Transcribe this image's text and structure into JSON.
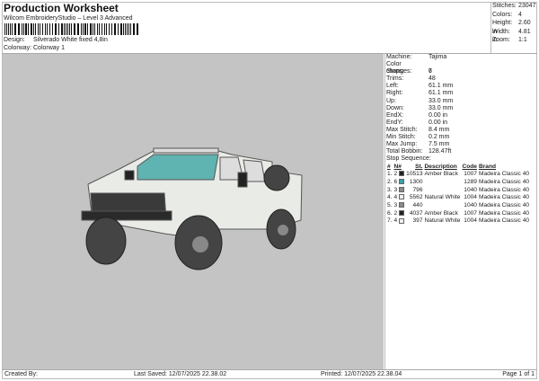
{
  "header": {
    "title": "Production Worksheet",
    "subtitle": "Wilcom EmbroideryStudio – Level 3 Advanced",
    "design_label": "Design:",
    "design": "Silverado White fixed 4,8in",
    "colorway_label": "Colorway:",
    "colorway": "Colorway 1"
  },
  "stats": [
    {
      "k": "Stitches:",
      "v": "23047"
    },
    {
      "k": "Colors:",
      "v": "4"
    },
    {
      "k": "Height:",
      "v": "2.60 in"
    },
    {
      "k": "Width:",
      "v": "4.81 in"
    },
    {
      "k": "Zoom:",
      "v": "1:1"
    }
  ],
  "info": [
    {
      "k": "Machine:",
      "v": "Tajima"
    },
    {
      "k": "Color changes:",
      "v": "6"
    },
    {
      "k": "Stops:",
      "v": "7"
    },
    {
      "k": "Trims:",
      "v": "48"
    },
    {
      "k": "Left:",
      "v": "61.1 mm"
    },
    {
      "k": "Right:",
      "v": "61.1 mm"
    },
    {
      "k": "Up:",
      "v": "33.0 mm"
    },
    {
      "k": "Down:",
      "v": "33.0 mm"
    },
    {
      "k": "EndX:",
      "v": "0.00 in"
    },
    {
      "k": "EndY:",
      "v": "0.00 in"
    },
    {
      "k": "Max Stitch:",
      "v": "8.4 mm"
    },
    {
      "k": "Min Stitch:",
      "v": "0.2 mm"
    },
    {
      "k": "Max Jump:",
      "v": "7.5 mm"
    },
    {
      "k": "Total Bobbin:",
      "v": "128.47ft"
    }
  ],
  "stop_sequence": {
    "label": "Stop Sequence:",
    "headers": [
      "#",
      "N#",
      "St.",
      "Description",
      "Code",
      "Brand"
    ],
    "rows": [
      {
        "i": "1.",
        "n": "2",
        "color": "#222222",
        "st": "10513",
        "desc": "Amber Black",
        "code": "1007",
        "brand": "Madeira Classic 40"
      },
      {
        "i": "2.",
        "n": "6",
        "color": "#3aa0a8",
        "st": "1300",
        "desc": "",
        "code": "1289",
        "brand": "Madeira Classic 40"
      },
      {
        "i": "3.",
        "n": "3",
        "color": "#8a8a8a",
        "st": "796",
        "desc": "",
        "code": "1040",
        "brand": "Madeira Classic 40"
      },
      {
        "i": "4.",
        "n": "4",
        "color": "#eeeeee",
        "st": "5562",
        "desc": "Natural White",
        "code": "1004",
        "brand": "Madeira Classic 40"
      },
      {
        "i": "5.",
        "n": "3",
        "color": "#8a8a8a",
        "st": "440",
        "desc": "",
        "code": "1040",
        "brand": "Madeira Classic 40"
      },
      {
        "i": "6.",
        "n": "2",
        "color": "#222222",
        "st": "4037",
        "desc": "Amber Black",
        "code": "1007",
        "brand": "Madeira Classic 40"
      },
      {
        "i": "7.",
        "n": "4",
        "color": "#eeeeee",
        "st": "397",
        "desc": "Natural White",
        "code": "1004",
        "brand": "Madeira Classic 40"
      }
    ]
  },
  "footer": {
    "created": "Created By:",
    "saved": "Last Saved: 12/07/2025 22.38.02",
    "printed": "Printed: 12/07/2025 22.38.04",
    "page": "Page 1 of 1"
  }
}
